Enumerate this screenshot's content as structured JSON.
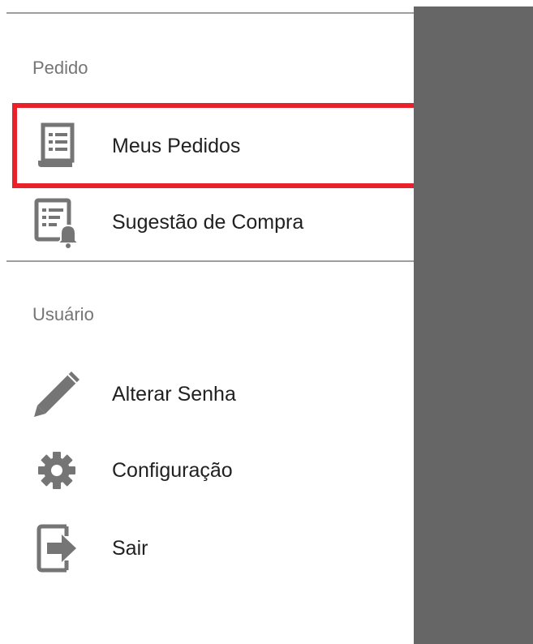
{
  "sections": {
    "pedido": {
      "header": "Pedido",
      "items": [
        {
          "label": "Meus Pedidos",
          "icon": "order-list-icon"
        },
        {
          "label": "Sugestão de Compra",
          "icon": "purchase-suggestion-icon"
        }
      ]
    },
    "usuario": {
      "header": "Usuário",
      "items": [
        {
          "label": "Alterar Senha",
          "icon": "pencil-icon"
        },
        {
          "label": "Configuração",
          "icon": "gear-icon"
        },
        {
          "label": "Sair",
          "icon": "logout-icon"
        }
      ]
    }
  },
  "colors": {
    "highlight": "#e8212a",
    "icon": "#757575",
    "scrim": "#666666",
    "text": "#212121"
  }
}
